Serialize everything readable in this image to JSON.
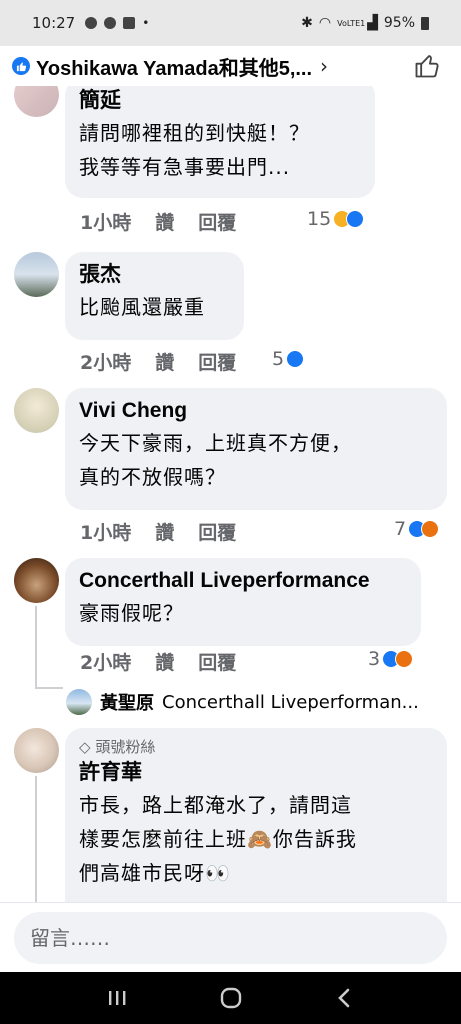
{
  "status_bar": {
    "time": "10:27",
    "dot": "•",
    "network": "VoLTE1",
    "battery": "95%"
  },
  "header": {
    "title": "Yoshikawa Yamada和其他5,...",
    "chevron": "›"
  },
  "actions": {
    "like": "讚",
    "reply": "回覆"
  },
  "comments": [
    {
      "author": "簡延",
      "lines": [
        "請問哪裡租的到快艇！？",
        "我等等有急事要出門..."
      ],
      "time": "1小時",
      "reaction_count": "15",
      "reactions": [
        "haha",
        "like"
      ]
    },
    {
      "author": "張杰",
      "lines": [
        "比颱風還嚴重"
      ],
      "time": "2小時",
      "reaction_count": "5",
      "reactions": [
        "like"
      ]
    },
    {
      "author": "Vivi Cheng",
      "lines": [
        "今天下豪雨，上班真不方便，",
        "真的不放假嗎？"
      ],
      "time": "1小時",
      "reaction_count": "7",
      "reactions": [
        "like",
        "angry"
      ]
    },
    {
      "author": "Concerthall Liveperformance",
      "lines": [
        "豪雨假呢？"
      ],
      "time": "2小時",
      "reaction_count": "3",
      "reactions": [
        "like",
        "angry"
      ],
      "reply_preview": {
        "author": "黃聖原",
        "text": "Concerthall Liveperforman..."
      }
    },
    {
      "badge": "頭號粉絲",
      "author": "許育華",
      "lines": [
        "市長，路上都淹水了，請問這",
        "樣要怎麼前往上班🙈你告訴我",
        "們高雄市民呀👀"
      ]
    }
  ],
  "input": {
    "placeholder": "留言……"
  },
  "nav": {
    "recent": "recent-apps-icon",
    "home": "home-icon",
    "back": "back-icon"
  }
}
